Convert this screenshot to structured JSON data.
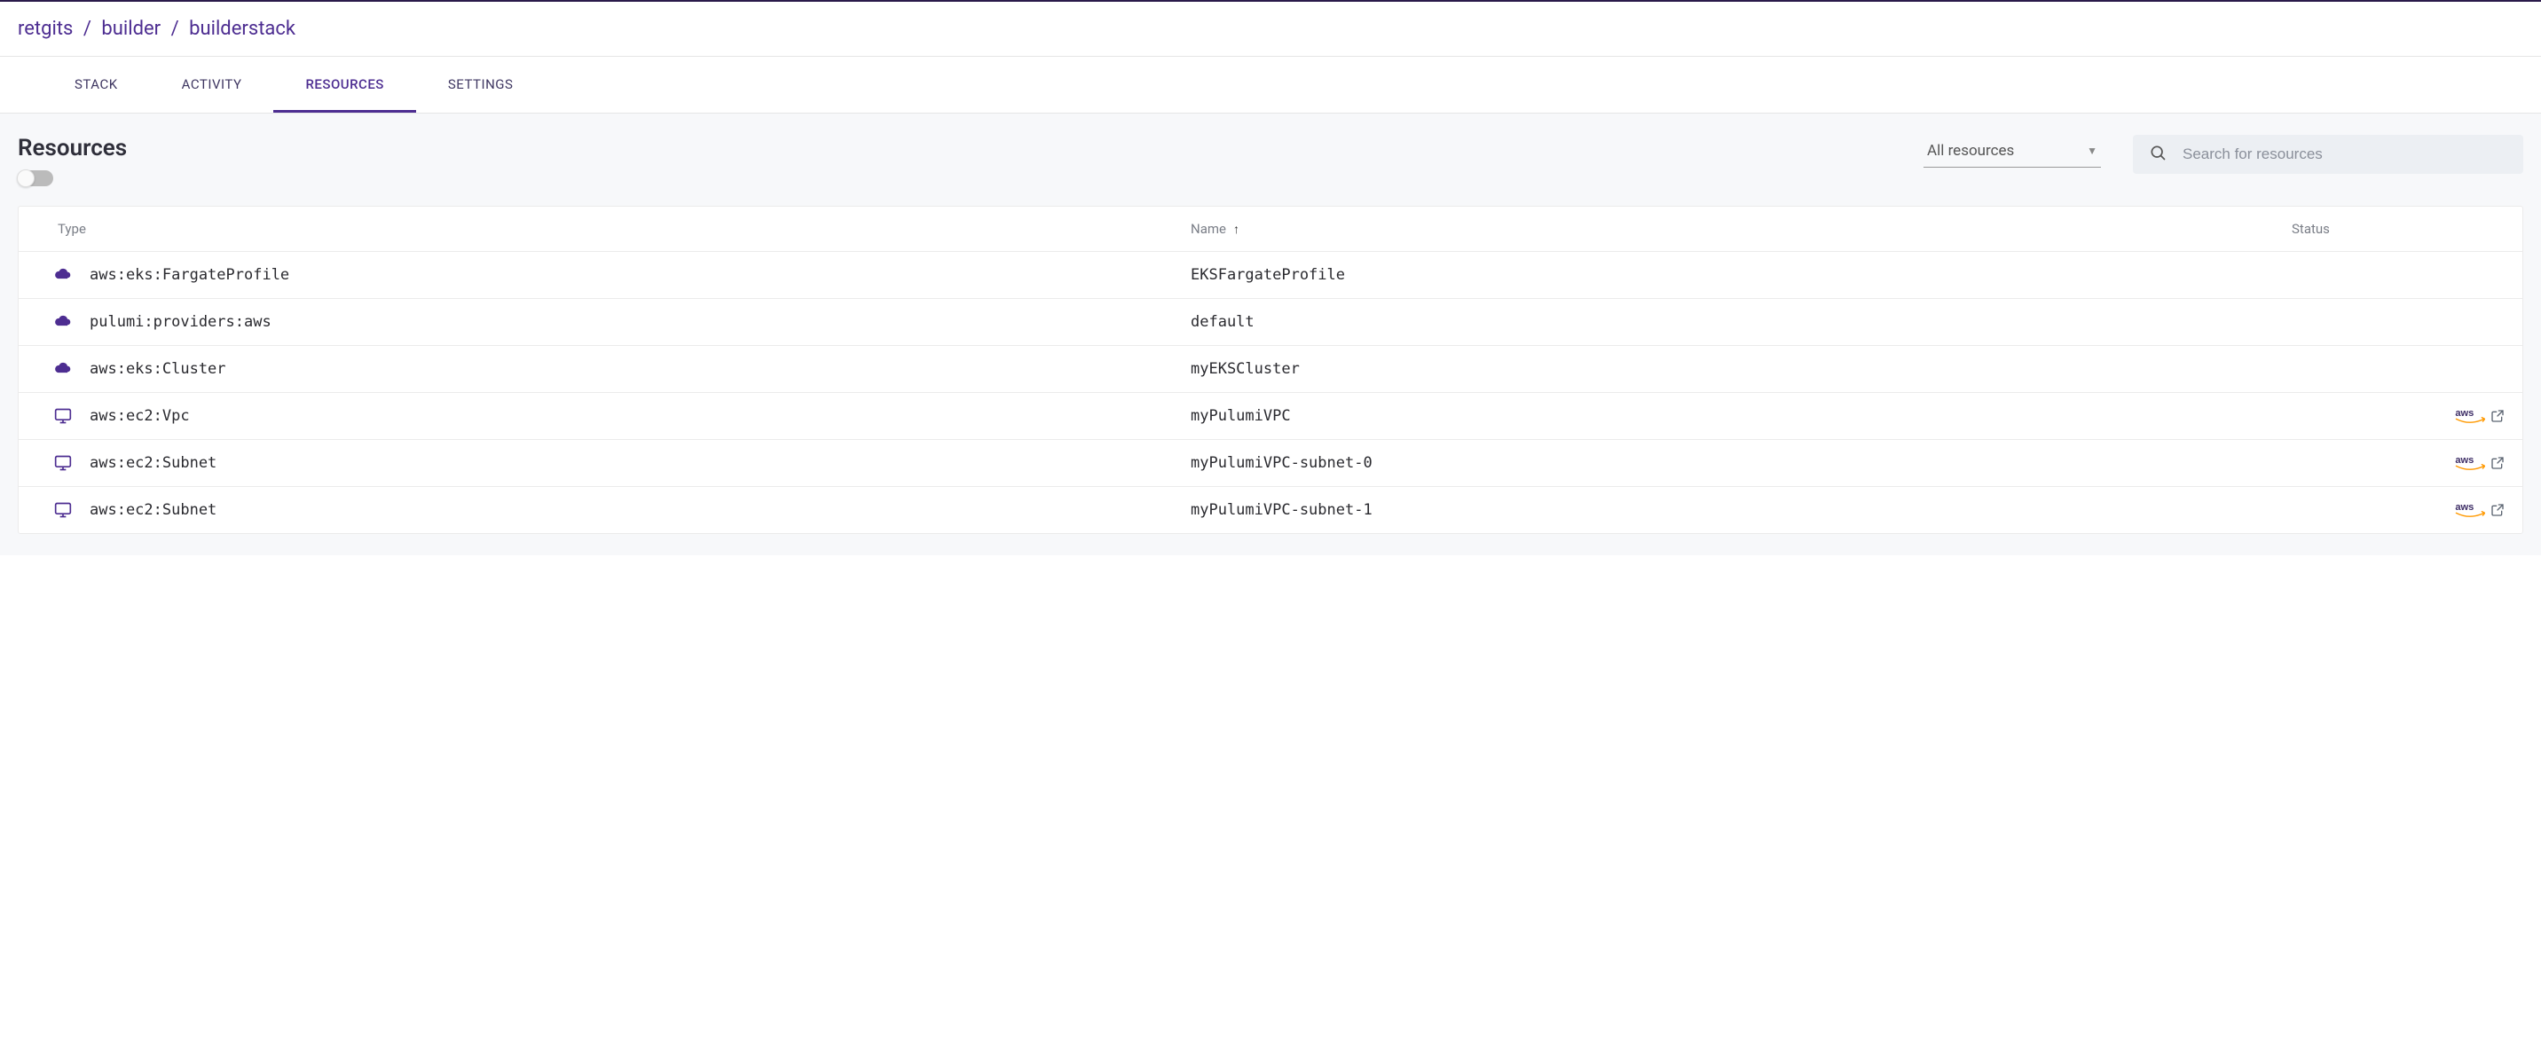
{
  "breadcrumb": {
    "org": "retgits",
    "project": "builder",
    "stack": "builderstack"
  },
  "tabs": {
    "stack": "STACK",
    "activity": "ACTIVITY",
    "resources": "RESOURCES",
    "settings": "SETTINGS",
    "active": "resources"
  },
  "page": {
    "title": "Resources"
  },
  "filter": {
    "selected": "All resources"
  },
  "search": {
    "placeholder": "Search for resources",
    "value": ""
  },
  "columns": {
    "type": "Type",
    "name": "Name",
    "status": "Status"
  },
  "icons": {
    "cloud": "cloud",
    "monitor": "monitor"
  },
  "rows": [
    {
      "icon": "cloud",
      "type": "aws:eks:FargateProfile",
      "name": "EKSFargateProfile",
      "hasLink": false
    },
    {
      "icon": "cloud",
      "type": "pulumi:providers:aws",
      "name": "default",
      "hasLink": false
    },
    {
      "icon": "cloud",
      "type": "aws:eks:Cluster",
      "name": "myEKSCluster",
      "hasLink": false
    },
    {
      "icon": "monitor",
      "type": "aws:ec2:Vpc",
      "name": "myPulumiVPC",
      "hasLink": true
    },
    {
      "icon": "monitor",
      "type": "aws:ec2:Subnet",
      "name": "myPulumiVPC-subnet-0",
      "hasLink": true
    },
    {
      "icon": "monitor",
      "type": "aws:ec2:Subnet",
      "name": "myPulumiVPC-subnet-1",
      "hasLink": true
    }
  ],
  "linkLabel": "aws"
}
